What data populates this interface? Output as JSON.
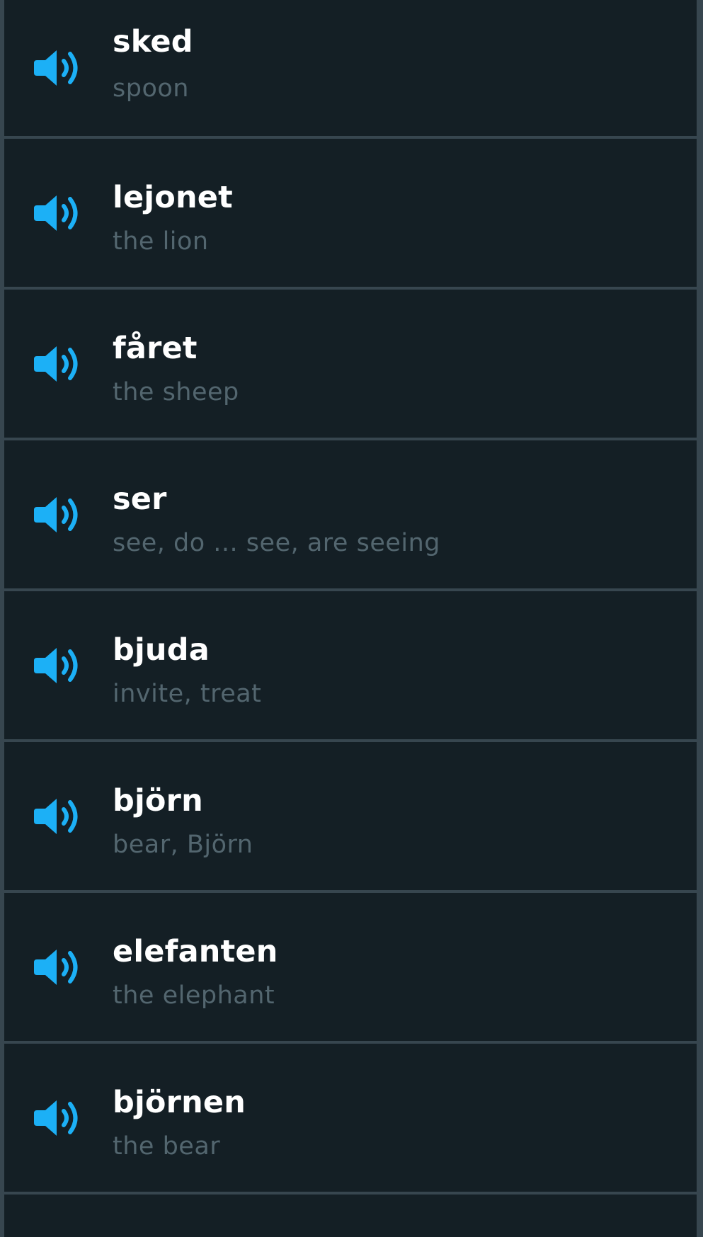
{
  "colors": {
    "background": "#141f25",
    "divider": "#37464f",
    "word": "#ffffff",
    "translation": "#53666f",
    "speaker_icon": "#1cb0f6"
  },
  "words": [
    {
      "word": "sked",
      "translation": "spoon",
      "icon": "speaker-icon"
    },
    {
      "word": "lejonet",
      "translation": "the lion",
      "icon": "speaker-icon"
    },
    {
      "word": "fåret",
      "translation": "the sheep",
      "icon": "speaker-icon"
    },
    {
      "word": "ser",
      "translation": "see, do ... see, are seeing",
      "icon": "speaker-icon"
    },
    {
      "word": "bjuda",
      "translation": "invite, treat",
      "icon": "speaker-icon"
    },
    {
      "word": "björn",
      "translation": "bear, Björn",
      "icon": "speaker-icon"
    },
    {
      "word": "elefanten",
      "translation": "the elephant",
      "icon": "speaker-icon"
    },
    {
      "word": "björnen",
      "translation": "the bear",
      "icon": "speaker-icon"
    }
  ]
}
